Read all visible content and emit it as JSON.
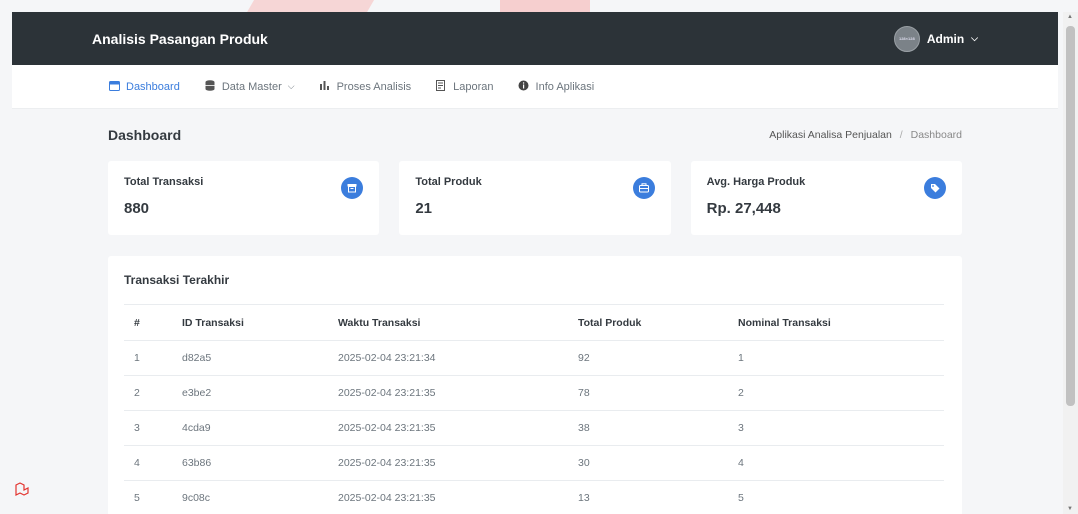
{
  "header": {
    "brand": "Analisis Pasangan Produk",
    "user": "Admin",
    "avatar_text": "128×128"
  },
  "nav": [
    {
      "label": "Dashboard",
      "icon": "calendar-icon"
    },
    {
      "label": "Data Master",
      "icon": "database-icon",
      "dropdown": "⌵"
    },
    {
      "label": "Proses Analisis",
      "icon": "bar-chart-icon"
    },
    {
      "label": "Laporan",
      "icon": "report-icon"
    },
    {
      "label": "Info Aplikasi",
      "icon": "info-icon"
    }
  ],
  "page": {
    "title": "Dashboard",
    "breadcrumb_root": "Aplikasi Analisa Penjualan",
    "breadcrumb_current": "Dashboard"
  },
  "stats": [
    {
      "label": "Total Transaksi",
      "value": "880",
      "icon": "archive-icon"
    },
    {
      "label": "Total Produk",
      "value": "21",
      "icon": "briefcase-icon"
    },
    {
      "label": "Avg. Harga Produk",
      "value": "Rp. 27,448",
      "icon": "tag-icon"
    }
  ],
  "table": {
    "title": "Transaksi Terakhir",
    "headers": [
      "#",
      "ID Transaksi",
      "Waktu Transaksi",
      "Total Produk",
      "Nominal Transaksi"
    ],
    "rows": [
      [
        "1",
        "d82a5",
        "2025-02-04 23:21:34",
        "92",
        "1"
      ],
      [
        "2",
        "e3be2",
        "2025-02-04 23:21:35",
        "78",
        "2"
      ],
      [
        "3",
        "4cda9",
        "2025-02-04 23:21:35",
        "38",
        "3"
      ],
      [
        "4",
        "63b86",
        "2025-02-04 23:21:35",
        "30",
        "4"
      ],
      [
        "5",
        "9c08c",
        "2025-02-04 23:21:35",
        "13",
        "5"
      ]
    ]
  },
  "colors": {
    "accent": "#3b7ddd",
    "topbar": "#2c3338"
  }
}
